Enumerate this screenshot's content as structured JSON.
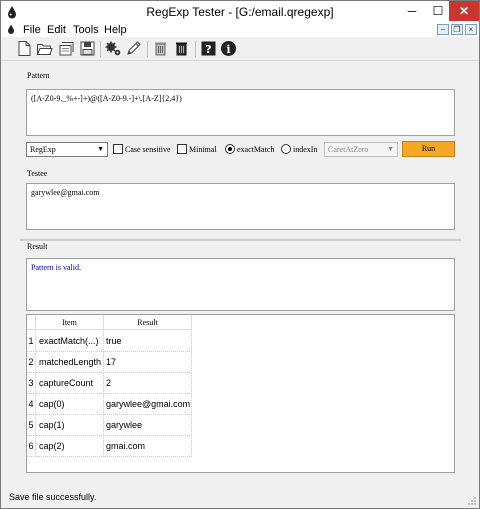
{
  "window": {
    "title": "RegExp Tester - [G:/email.qregexp]",
    "minimize": "─",
    "maximize": "☐",
    "close": "✕"
  },
  "menu": {
    "items": [
      "File",
      "Edit",
      "Tools",
      "Help"
    ],
    "mdi": {
      "minimize": "–",
      "restore": "❐",
      "close": "×"
    }
  },
  "toolbar": {
    "icons": [
      "new-file-icon",
      "open-folder-icon",
      "open-file-icon",
      "save-icon",
      "settings-icon",
      "edit-pencil-icon",
      "delete-icon",
      "trash-icon",
      "help-icon",
      "info-icon"
    ]
  },
  "pattern": {
    "label": "Pattern",
    "value": "([A-Z0-9._%+-]+)@([A-Z0-9.-]+\\.[A-Z]{2,4})"
  },
  "options": {
    "syntax": "RegExp",
    "case_sensitive": "Case sensitive",
    "minimal": "Minimal",
    "exact_match": "exactMatch",
    "index_in": "indexIn",
    "caret_mode": "CaretAtZero",
    "run": "Run"
  },
  "testee": {
    "label": "Testee",
    "value": "garywlee@gmai.com"
  },
  "result": {
    "label": "Result",
    "message": "Pattern is valid.",
    "columns": [
      "Item",
      "Result"
    ],
    "rows": [
      {
        "n": "1",
        "item": "exactMatch(...)",
        "result": "true"
      },
      {
        "n": "2",
        "item": "matchedLength",
        "result": "17"
      },
      {
        "n": "3",
        "item": "captureCount",
        "result": "2"
      },
      {
        "n": "4",
        "item": "cap(0)",
        "result": "garywlee@gmai.com"
      },
      {
        "n": "5",
        "item": "cap(1)",
        "result": "garywlee"
      },
      {
        "n": "6",
        "item": "cap(2)",
        "result": "gmai.com"
      }
    ]
  },
  "status": {
    "text": "Save file successfully."
  },
  "colors": {
    "run_button": "#f7a823",
    "valid_message": "#0000cc",
    "close_button": "#c7372f"
  }
}
